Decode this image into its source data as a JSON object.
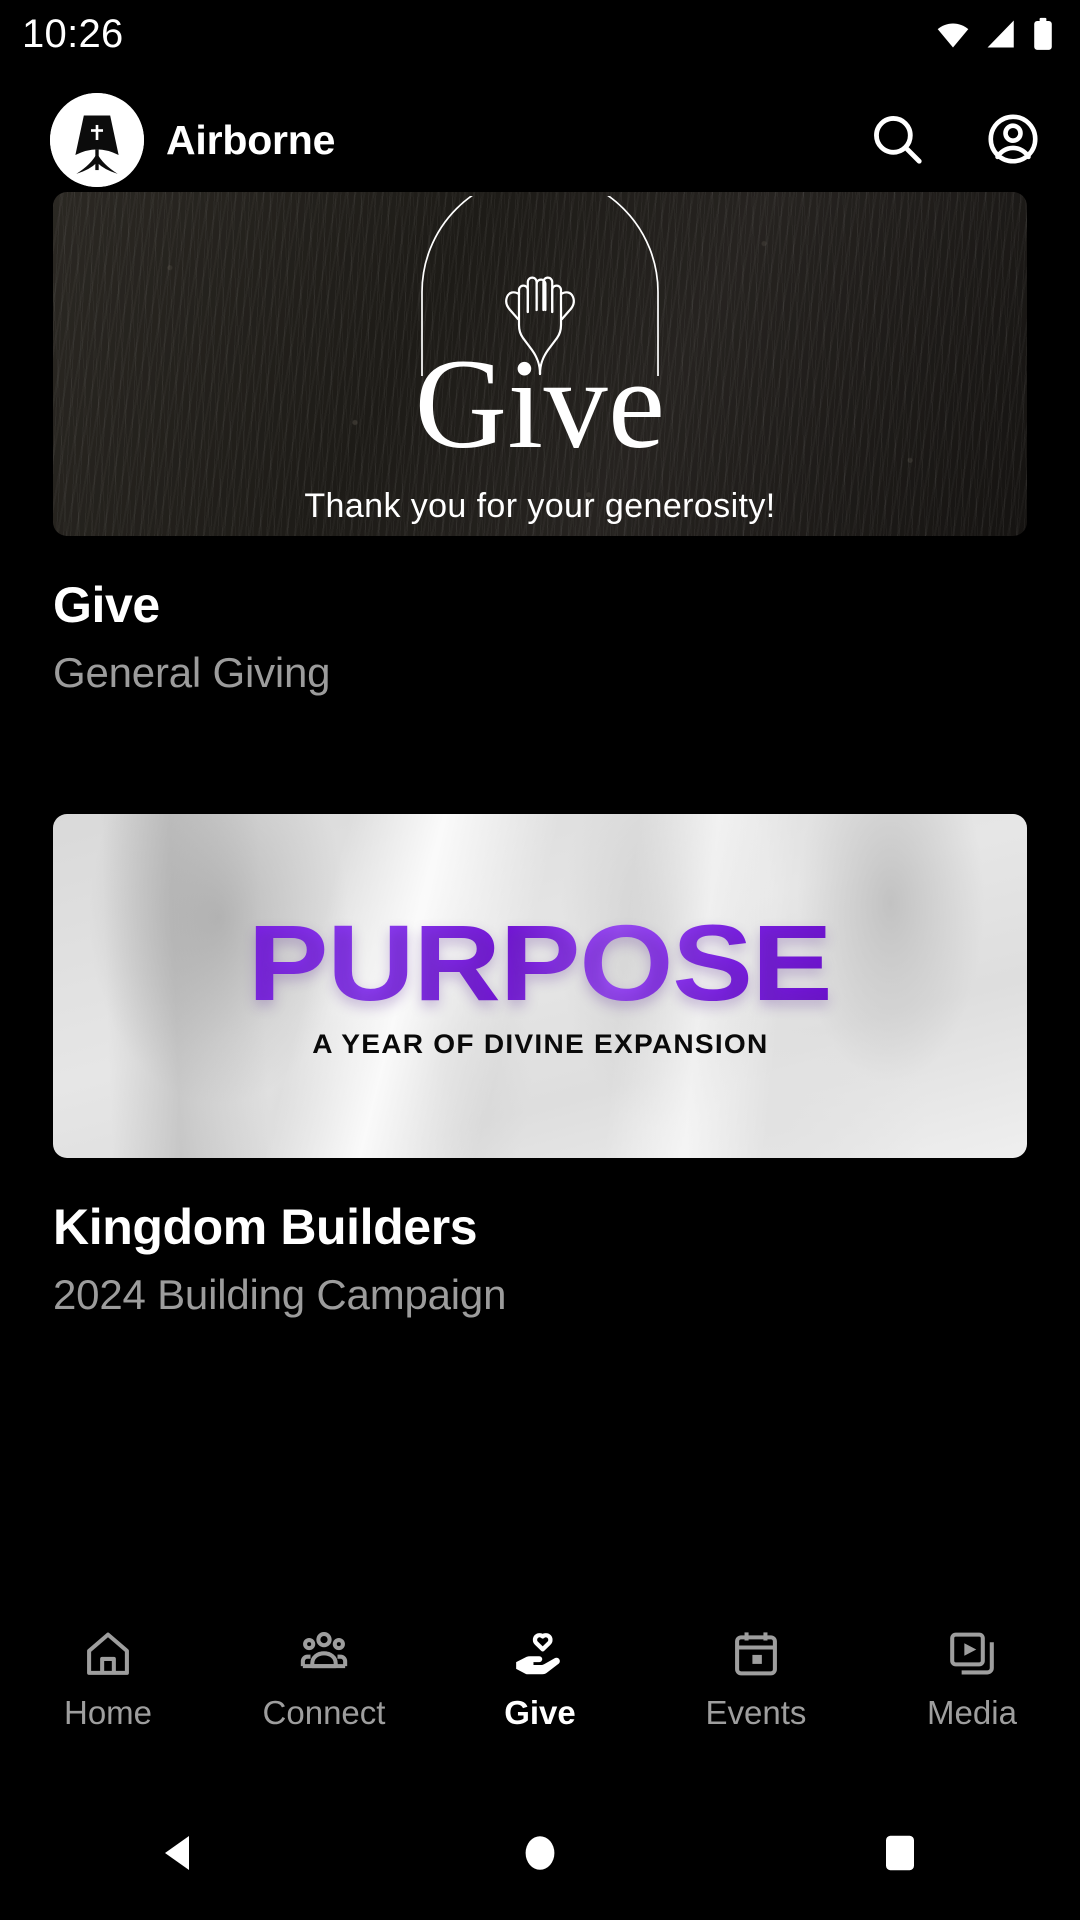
{
  "status_bar": {
    "time": "10:26",
    "icons": [
      "wifi-icon",
      "cellular-signal-icon",
      "battery-icon"
    ]
  },
  "header": {
    "logo_icon": "airborne-logo-icon",
    "brand_name": "Airborne",
    "actions": [
      {
        "icon": "search-icon",
        "label": "Search"
      },
      {
        "icon": "account-circle-icon",
        "label": "Account"
      }
    ]
  },
  "colors": {
    "background": "#000000",
    "primary_text": "#ffffff",
    "secondary_text": "#9c9c9c",
    "inactive_tab": "#9e9e9e",
    "accent_purple": "#7b1fe3"
  },
  "give_cards": [
    {
      "title": "Give",
      "subtitle": "General Giving",
      "image": {
        "kind": "give-banner",
        "headline": "Give",
        "tagline": "Thank you for your generosity!",
        "art_icon": "open-hands-under-arch-icon",
        "background_description": "dark-weathered-wood-texture"
      }
    },
    {
      "title": "Kingdom Builders",
      "subtitle": "2024 Building Campaign",
      "image": {
        "kind": "purpose-banner",
        "headline": "PURPOSE",
        "tagline": "A YEAR OF DIVINE EXPANSION",
        "art_icon": "raised-hands-photo",
        "background_description": "light-grayscale-worship-photo"
      }
    }
  ],
  "tab_bar": {
    "active": "Give",
    "tabs": [
      {
        "label": "Home",
        "icon": "home-icon",
        "active": false
      },
      {
        "label": "Connect",
        "icon": "people-icon",
        "active": false
      },
      {
        "label": "Give",
        "icon": "hand-heart-icon",
        "active": true
      },
      {
        "label": "Events",
        "icon": "calendar-icon",
        "active": false
      },
      {
        "label": "Media",
        "icon": "media-play-icon",
        "active": false
      }
    ]
  },
  "system_nav": {
    "buttons": [
      {
        "name": "back-icon",
        "label": "Back"
      },
      {
        "name": "home-icon",
        "label": "Home"
      },
      {
        "name": "recents-icon",
        "label": "Recent apps"
      }
    ]
  }
}
